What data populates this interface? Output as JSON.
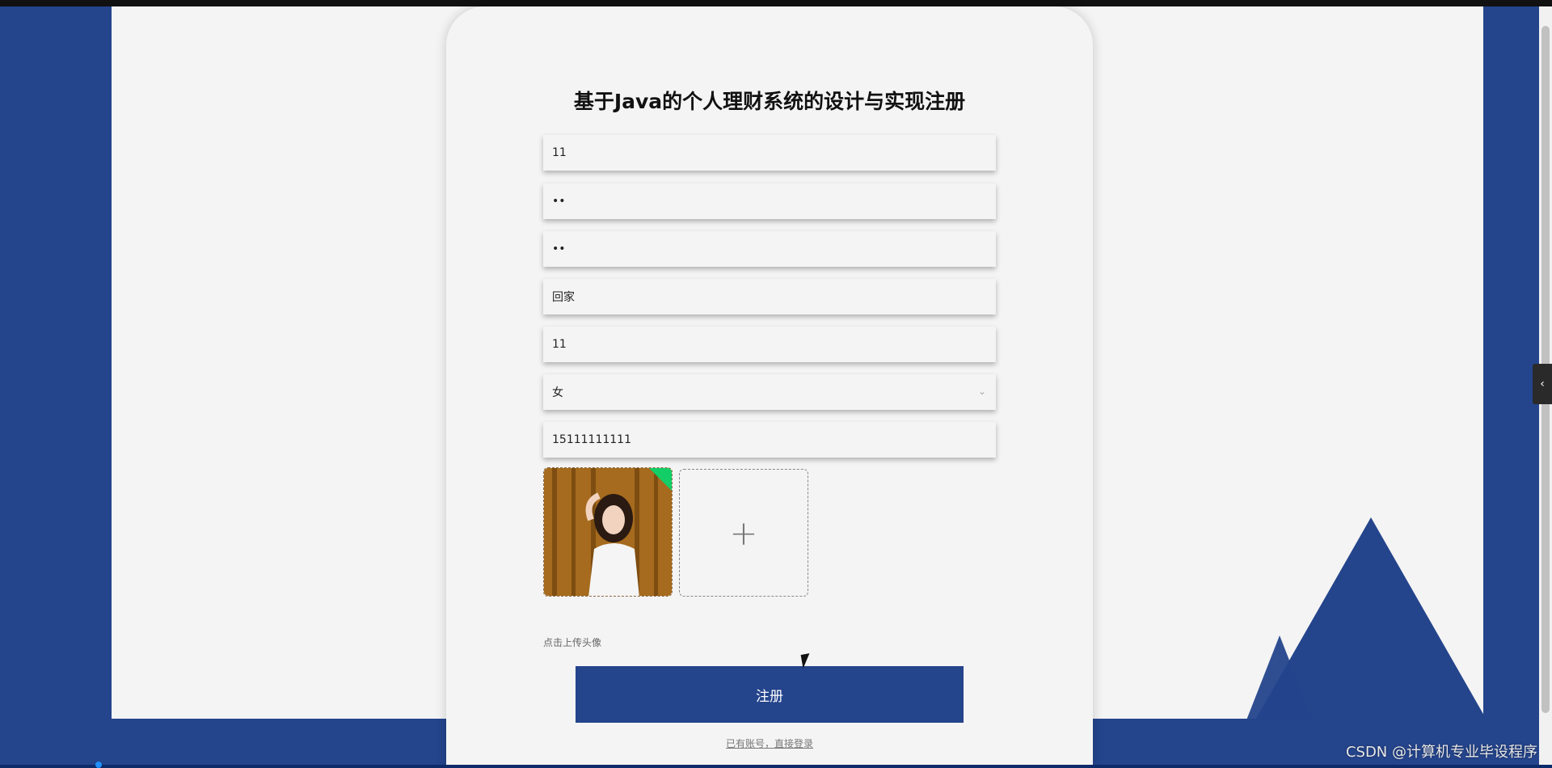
{
  "page": {
    "title": "基于Java的个人理财系统的设计与实现注册",
    "watermark": "CSDN @计算机专业毕设程序"
  },
  "form": {
    "fields": [
      {
        "value": "11"
      },
      {
        "value": "••"
      },
      {
        "value": "••"
      },
      {
        "value": "回家"
      },
      {
        "value": "11"
      },
      {
        "value": "女"
      },
      {
        "value": "15111111111"
      }
    ],
    "upload_hint": "点击上传头像",
    "submit_label": "注册",
    "login_link": "已有账号，直接登录"
  },
  "icons": {
    "add": "+",
    "chevron_down": "⌄",
    "side_toggle": "‹"
  },
  "colors": {
    "brand": "#24448c",
    "background": "#f4f4f4",
    "success": "#13ce66"
  }
}
